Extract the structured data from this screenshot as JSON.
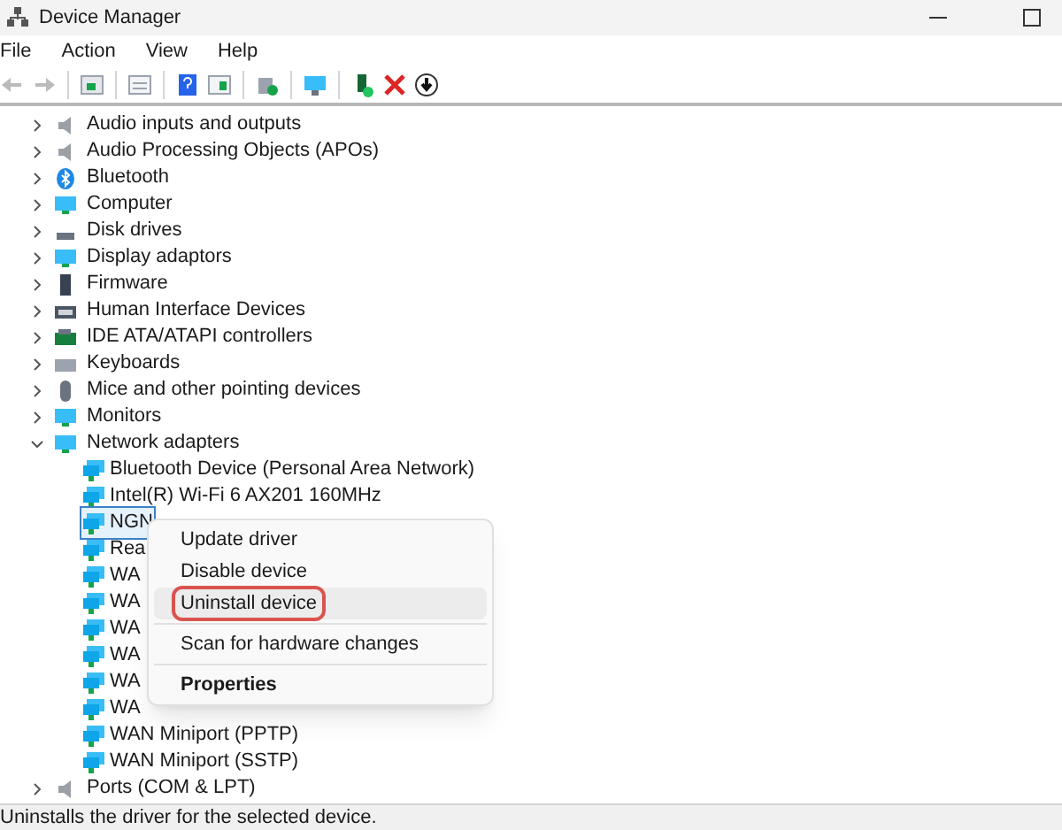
{
  "window": {
    "title": "Device Manager"
  },
  "menu": [
    "File",
    "Action",
    "View",
    "Help"
  ],
  "tree": [
    {
      "label": "Audio inputs and outputs",
      "expanded": false
    },
    {
      "label": "Audio Processing Objects (APOs)",
      "expanded": false
    },
    {
      "label": "Bluetooth",
      "expanded": false
    },
    {
      "label": "Computer",
      "expanded": false
    },
    {
      "label": "Disk drives",
      "expanded": false
    },
    {
      "label": "Display adaptors",
      "expanded": false
    },
    {
      "label": "Firmware",
      "expanded": false
    },
    {
      "label": "Human Interface Devices",
      "expanded": false
    },
    {
      "label": "IDE ATA/ATAPI controllers",
      "expanded": false
    },
    {
      "label": "Keyboards",
      "expanded": false
    },
    {
      "label": "Mice and other pointing devices",
      "expanded": false
    },
    {
      "label": "Monitors",
      "expanded": false
    },
    {
      "label": "Network adapters",
      "expanded": true,
      "children": [
        {
          "label": "Bluetooth Device (Personal Area Network)",
          "selected": false
        },
        {
          "label": "Intel(R) Wi-Fi 6 AX201 160MHz",
          "selected": false
        },
        {
          "label": "NGN",
          "selected": true
        },
        {
          "label": "Rea",
          "selected": false
        },
        {
          "label": "WA",
          "selected": false
        },
        {
          "label": "WA",
          "selected": false
        },
        {
          "label": "WA",
          "selected": false
        },
        {
          "label": "WA",
          "selected": false
        },
        {
          "label": "WA",
          "selected": false
        },
        {
          "label": "WA",
          "selected": false
        },
        {
          "label": "WAN Miniport (PPTP)",
          "selected": false
        },
        {
          "label": "WAN Miniport (SSTP)",
          "selected": false
        }
      ]
    },
    {
      "label": "Ports (COM & LPT)",
      "expanded": false
    }
  ],
  "context_menu": [
    {
      "kind": "item",
      "label": "Update driver",
      "selected": false,
      "default": false
    },
    {
      "kind": "item",
      "label": "Disable device",
      "selected": false,
      "default": false
    },
    {
      "kind": "item",
      "label": "Uninstall device",
      "selected": true,
      "default": false
    },
    {
      "kind": "separator"
    },
    {
      "kind": "item",
      "label": "Scan for hardware changes",
      "selected": false,
      "default": false
    },
    {
      "kind": "separator"
    },
    {
      "kind": "item",
      "label": "Properties",
      "selected": false,
      "default": true
    }
  ],
  "status_bar": "Uninstalls the driver for the selected device."
}
